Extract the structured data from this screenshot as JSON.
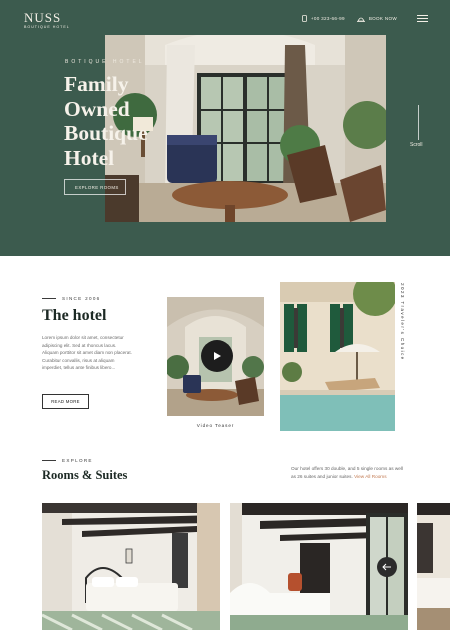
{
  "brand": {
    "name": "NUSS",
    "tagline": "BOUTIQUE HOTEL"
  },
  "header": {
    "phone": "+00 323-66-99",
    "book_label": "BOOK NOW",
    "phone_icon": "phone-icon",
    "book_icon": "bell-icon",
    "menu_icon": "hamburger-icon"
  },
  "hero": {
    "kicker": "BOTIQUE HOTEL",
    "title_lines": [
      "Family",
      "Owned",
      "Boutique",
      "Hotel"
    ],
    "cta": "EXPLORE ROOMS",
    "scroll": "Scroll"
  },
  "about": {
    "since": "SINCE 2006",
    "title": "The hotel",
    "text": "Lorem ipsum dolor sit amet, consectetur adipiscing elit. Sed at rhoncus lacus. Aliquam porttitor sit amet diam non placerat. Curabitur convallis, risus at aliquam imperdiet, tellus ante finibus libero...",
    "cta": "READ MORE",
    "video_caption": "Video Teaser",
    "award": "2023 Traveler's Choice"
  },
  "rooms": {
    "label": "EXPLORE",
    "title": "Rooms & Suites",
    "text": "Our hotel offers 30 double, and 5 single rooms as well as 26 suites and junior suites.",
    "link": "View All Rooms"
  },
  "colors": {
    "hero_bg": "#3c5b4e",
    "accent_link": "#c27a52",
    "dark": "#1d2a25"
  }
}
